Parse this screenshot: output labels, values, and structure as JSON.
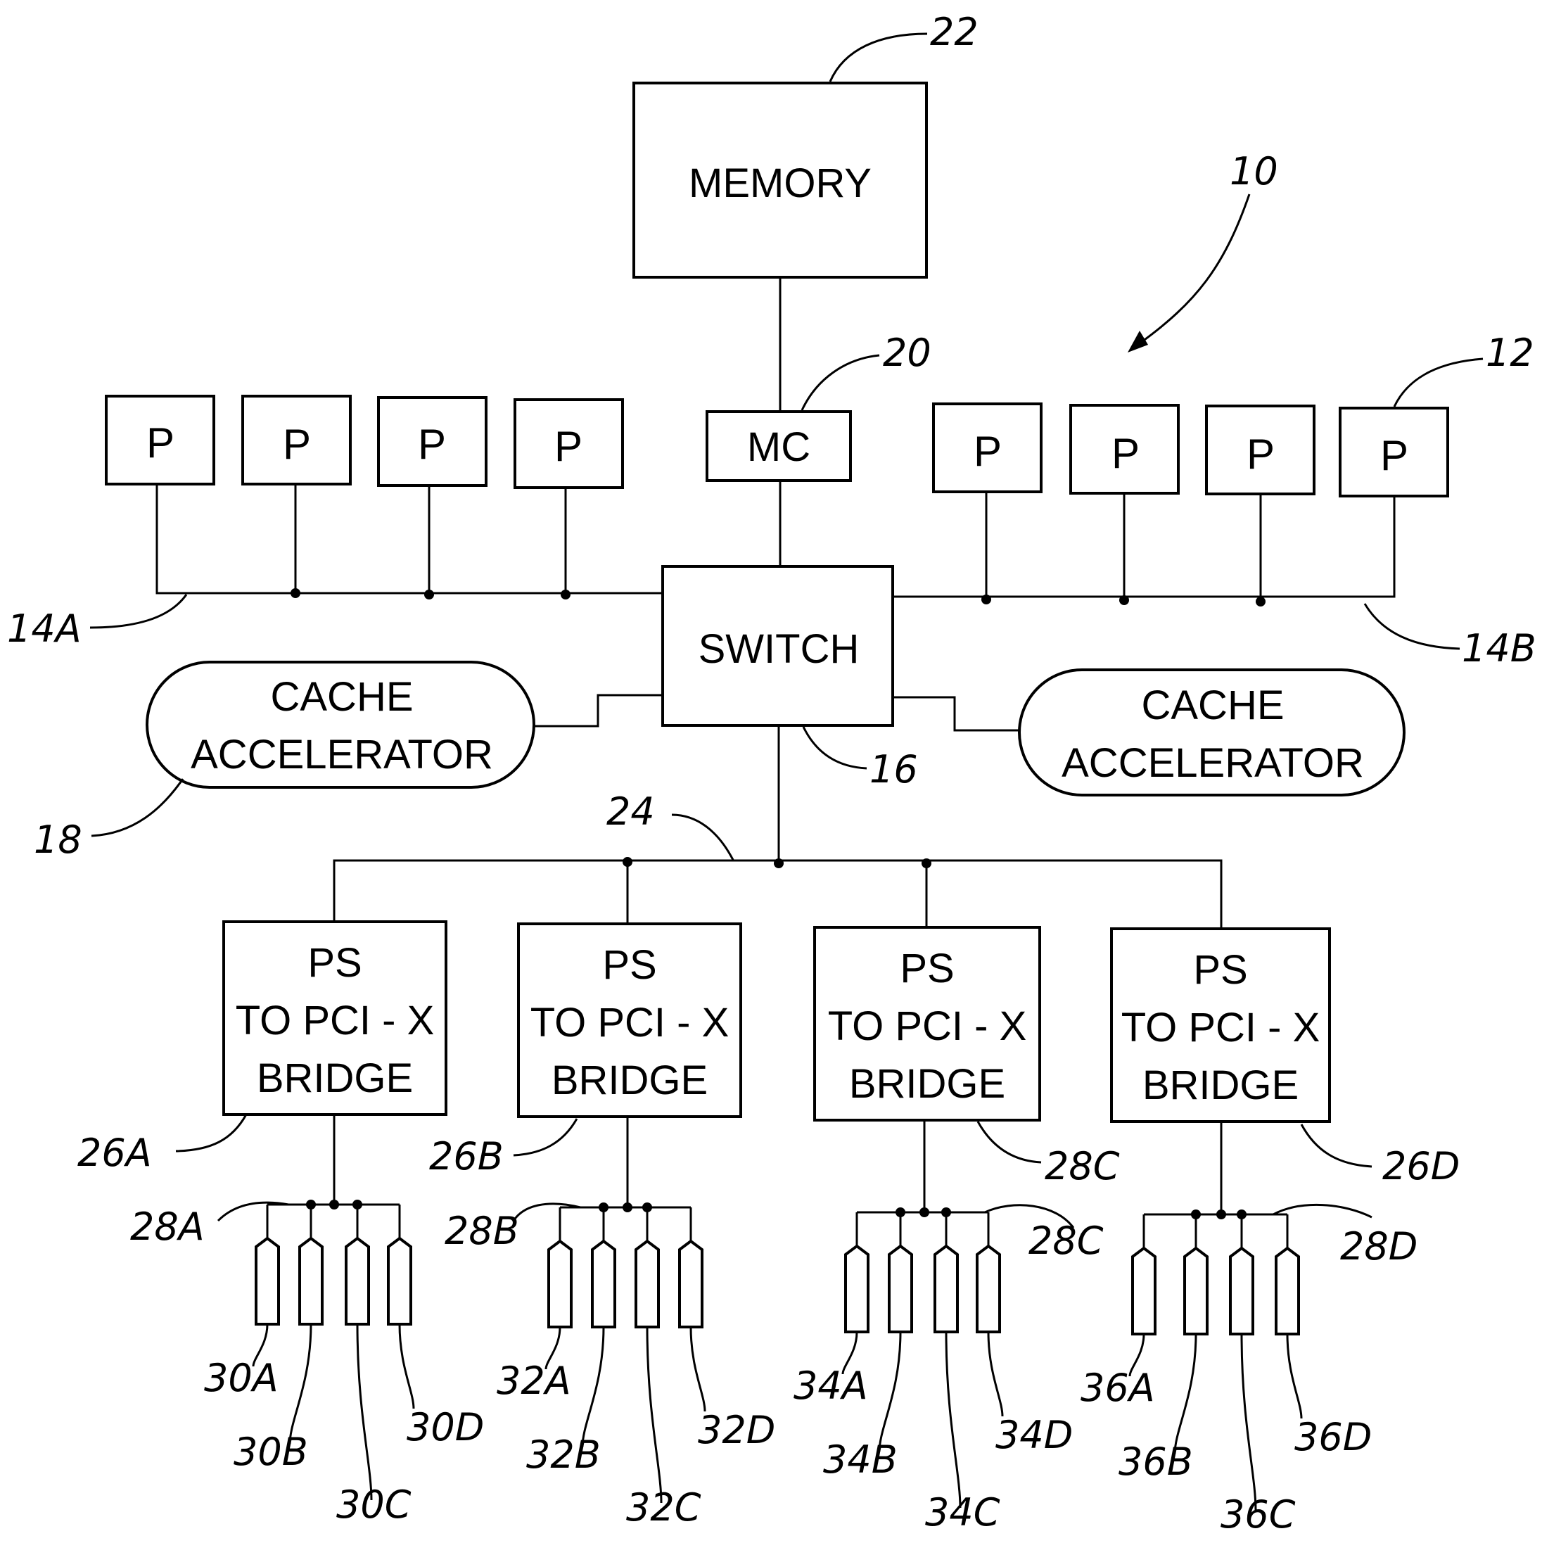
{
  "figure": {
    "system_ref": "10",
    "memory": {
      "label": "MEMORY",
      "ref": "22"
    },
    "memory_controller": {
      "label": "MC",
      "ref": "20"
    },
    "switch": {
      "label": "SWITCH",
      "ref": "16"
    },
    "processors_left": {
      "labels": [
        "P",
        "P",
        "P",
        "P"
      ],
      "bus_ref": "14A"
    },
    "processors_right": {
      "labels": [
        "P",
        "P",
        "P",
        "P"
      ],
      "bus_ref": "14B",
      "ref": "12"
    },
    "cache_left": {
      "line1": "CACHE",
      "line2": "ACCELERATOR",
      "ref": "18"
    },
    "cache_right": {
      "line1": "CACHE",
      "line2": "ACCELERATOR"
    },
    "pci_bus_ref": "24",
    "bridges": [
      {
        "line1": "PS",
        "line2": "TO PCI - X",
        "line3": "BRIDGE",
        "ref": "26A",
        "bus_ref": "28A",
        "slots": [
          "30A",
          "30B",
          "30C",
          "30D"
        ]
      },
      {
        "line1": "PS",
        "line2": "TO PCI - X",
        "line3": "BRIDGE",
        "ref": "26B",
        "bus_ref": "28B",
        "slots": [
          "32A",
          "32B",
          "32C",
          "32D"
        ]
      },
      {
        "line1": "PS",
        "line2": "TO PCI - X",
        "line3": "BRIDGE",
        "ref": "28C",
        "bus_ref": "28C",
        "slots": [
          "34A",
          "34B",
          "34C",
          "34D"
        ]
      },
      {
        "line1": "PS",
        "line2": "TO PCI - X",
        "line3": "BRIDGE",
        "ref": "26D",
        "bus_ref": "28D",
        "slots": [
          "36A",
          "36B",
          "36C",
          "36D"
        ]
      }
    ]
  }
}
